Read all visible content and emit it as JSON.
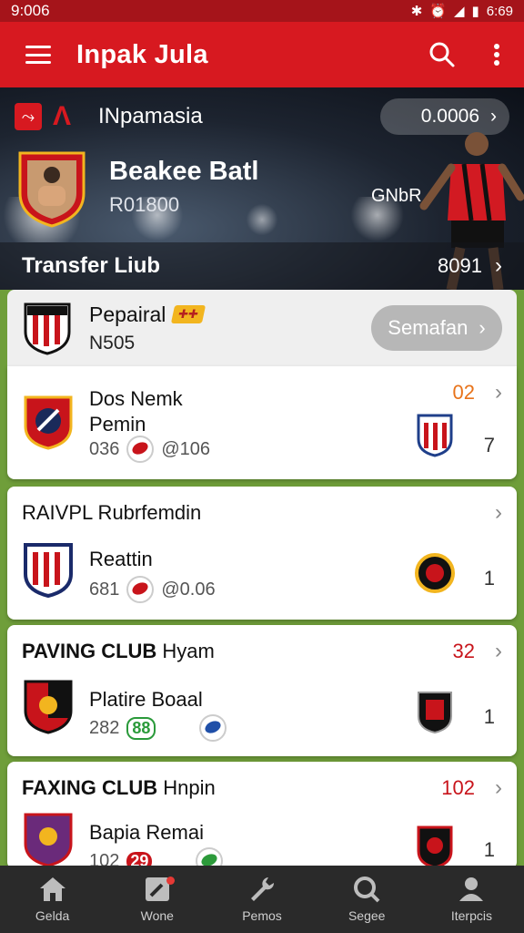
{
  "status_bar": {
    "time": "9:006",
    "right_time": "6:69"
  },
  "app_bar": {
    "title": "Inpak Jula",
    "menu_icon": "menu-icon",
    "search_icon": "search-icon",
    "more_icon": "more-vert-icon"
  },
  "hero": {
    "brand": "INpamasia",
    "pill_value": "0.0006",
    "player_name": "Beakee Batl",
    "player_code": "R01800",
    "player_tag": "GNbR",
    "strip_label": "Transfer Liub",
    "strip_value": "8091"
  },
  "featured": {
    "name": "Pepairal",
    "sub": "N505",
    "button": "Semafan"
  },
  "cards": [
    {
      "title": "",
      "number": "02",
      "team": "Dos Nemk\nPemin",
      "meta_a": "036",
      "meta_b": "@106",
      "score": "7"
    },
    {
      "title": "RAIVPL Rubrfemdin",
      "number": "",
      "team": "Reattin",
      "meta_a": "681",
      "meta_b": "@0.06",
      "score": "1"
    },
    {
      "title_bold": "PAVING CLUB",
      "title_rest": "Hyam",
      "number": "32",
      "team": "Platire Boaal",
      "meta_a": "282",
      "meta_b": "88",
      "score": "1"
    },
    {
      "title_bold": "FAXING CLUB",
      "title_rest": "Hnpin",
      "number": "102",
      "team": "Bapia Remai",
      "meta_a": "102",
      "meta_b": "29",
      "score": "1"
    }
  ],
  "bottom_nav": [
    {
      "label": "Gelda",
      "icon": "home-icon"
    },
    {
      "label": "Wone",
      "icon": "edit-icon"
    },
    {
      "label": "Pemos",
      "icon": "wrench-icon"
    },
    {
      "label": "Segee",
      "icon": "search-ball-icon"
    },
    {
      "label": "Iterpcis",
      "icon": "person-icon"
    }
  ]
}
